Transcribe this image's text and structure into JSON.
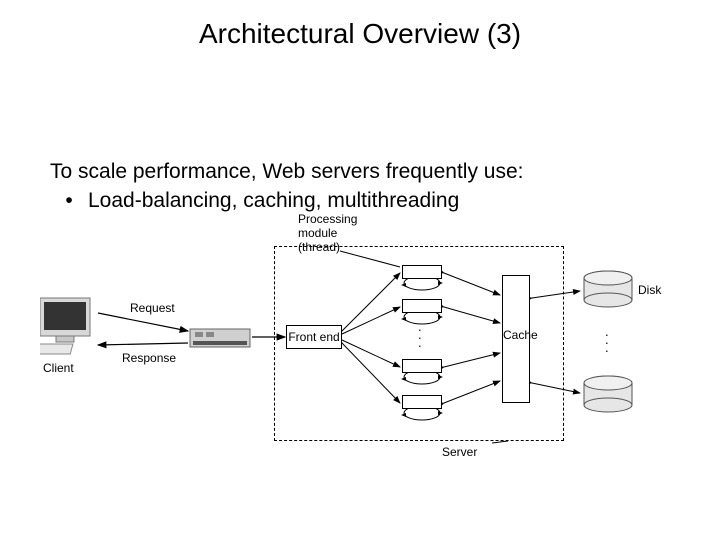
{
  "title": "Architectural Overview (3)",
  "intro": "To scale performance, Web servers frequently use:",
  "bullet_symbol": "•",
  "bullet_text": "Load-balancing, caching, multithreading",
  "diagram": {
    "client_label": "Client",
    "request_label": "Request",
    "response_label": "Response",
    "processing_label_l1": "Processing",
    "processing_label_l2": "module",
    "processing_label_l3": "(thread)",
    "front_end_label": "Front end",
    "cache_label": "Cache",
    "disk_label": "Disk",
    "server_label": "Server",
    "vdots": ". . ."
  }
}
